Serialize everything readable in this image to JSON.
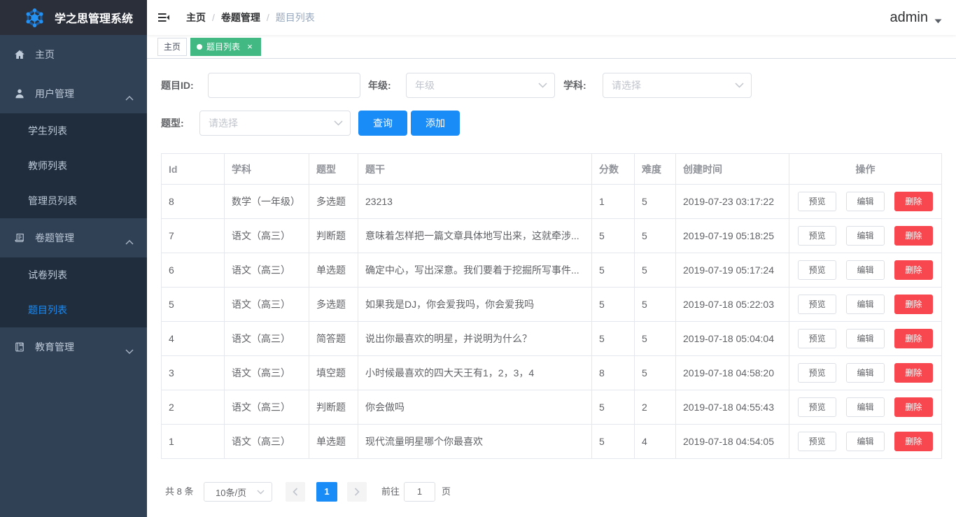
{
  "colors": {
    "primary": "#198cf8",
    "danger": "#f8474f",
    "tag-active": "#42b983",
    "sidebar-bg": "#304156",
    "submenu-bg": "#1f2d3d",
    "logo-bg": "#2b2f3a"
  },
  "sidebar": {
    "logo_title": "学之思管理系统",
    "menu": [
      {
        "label": "主页",
        "icon": "home-icon"
      },
      {
        "label": "用户管理",
        "icon": "user-icon",
        "expanded": true,
        "children": [
          "学生列表",
          "教师列表",
          "管理员列表"
        ]
      },
      {
        "label": "卷题管理",
        "icon": "exam-icon",
        "expanded": true,
        "children": [
          "试卷列表",
          "题目列表"
        ]
      },
      {
        "label": "教育管理",
        "icon": "education-icon",
        "expanded": false
      }
    ],
    "active_item": "题目列表"
  },
  "navbar": {
    "breadcrumb": [
      "主页",
      "卷题管理",
      "题目列表"
    ],
    "separator": "/",
    "username": "admin"
  },
  "tags": {
    "items": [
      {
        "label": "主页",
        "active": false
      },
      {
        "label": "题目列表",
        "active": true,
        "closable": true
      }
    ],
    "close_glyph": "×"
  },
  "filters": {
    "question_id": {
      "label": "题目ID:",
      "value": ""
    },
    "grade": {
      "label": "年级:",
      "placeholder": "年级"
    },
    "subject": {
      "label": "学科:",
      "placeholder": "请选择"
    },
    "question_type": {
      "label": "题型:",
      "placeholder": "请选择"
    },
    "query_button": "查询",
    "add_button": "添加"
  },
  "table": {
    "columns": [
      "Id",
      "学科",
      "题型",
      "题干",
      "分数",
      "难度",
      "创建时间",
      "操作"
    ],
    "actions": [
      "预览",
      "编辑",
      "删除"
    ],
    "rows": [
      {
        "id": "8",
        "subject": "数学（一年级）",
        "type": "多选题",
        "stem": "23213",
        "score": "1",
        "difficulty": "5",
        "created": "2019-07-23 03:17:22"
      },
      {
        "id": "7",
        "subject": "语文（高三）",
        "type": "判断题",
        "stem": "意味着怎样把一篇文章具体地写出来，这就牵涉...",
        "score": "5",
        "difficulty": "5",
        "created": "2019-07-19 05:18:25"
      },
      {
        "id": "6",
        "subject": "语文（高三）",
        "type": "单选题",
        "stem": "确定中心，写出深意。我们要着于挖掘所写事件...",
        "score": "5",
        "difficulty": "5",
        "created": "2019-07-19 05:17:24"
      },
      {
        "id": "5",
        "subject": "语文（高三）",
        "type": "多选题",
        "stem": "如果我是DJ，你会爱我吗，你会爱我吗",
        "score": "5",
        "difficulty": "5",
        "created": "2019-07-18 05:22:03"
      },
      {
        "id": "4",
        "subject": "语文（高三）",
        "type": "简答题",
        "stem": "说出你最喜欢的明星，并说明为什么？",
        "score": "5",
        "difficulty": "5",
        "created": "2019-07-18 05:04:04"
      },
      {
        "id": "3",
        "subject": "语文（高三）",
        "type": "填空题",
        "stem": "小时候最喜欢的四大天王有1，2，3，4",
        "score": "8",
        "difficulty": "5",
        "created": "2019-07-18 04:58:20"
      },
      {
        "id": "2",
        "subject": "语文（高三）",
        "type": "判断题",
        "stem": "你会做吗",
        "score": "5",
        "difficulty": "2",
        "created": "2019-07-18 04:55:43"
      },
      {
        "id": "1",
        "subject": "语文（高三）",
        "type": "单选题",
        "stem": "现代流量明星哪个你最喜欢",
        "score": "5",
        "difficulty": "4",
        "created": "2019-07-18 04:54:05"
      }
    ]
  },
  "pagination": {
    "total": "共 8 条",
    "page_size": "10条/页",
    "current_page": "1",
    "goto_label": "前往",
    "goto_value": "1",
    "goto_suffix": "页"
  }
}
